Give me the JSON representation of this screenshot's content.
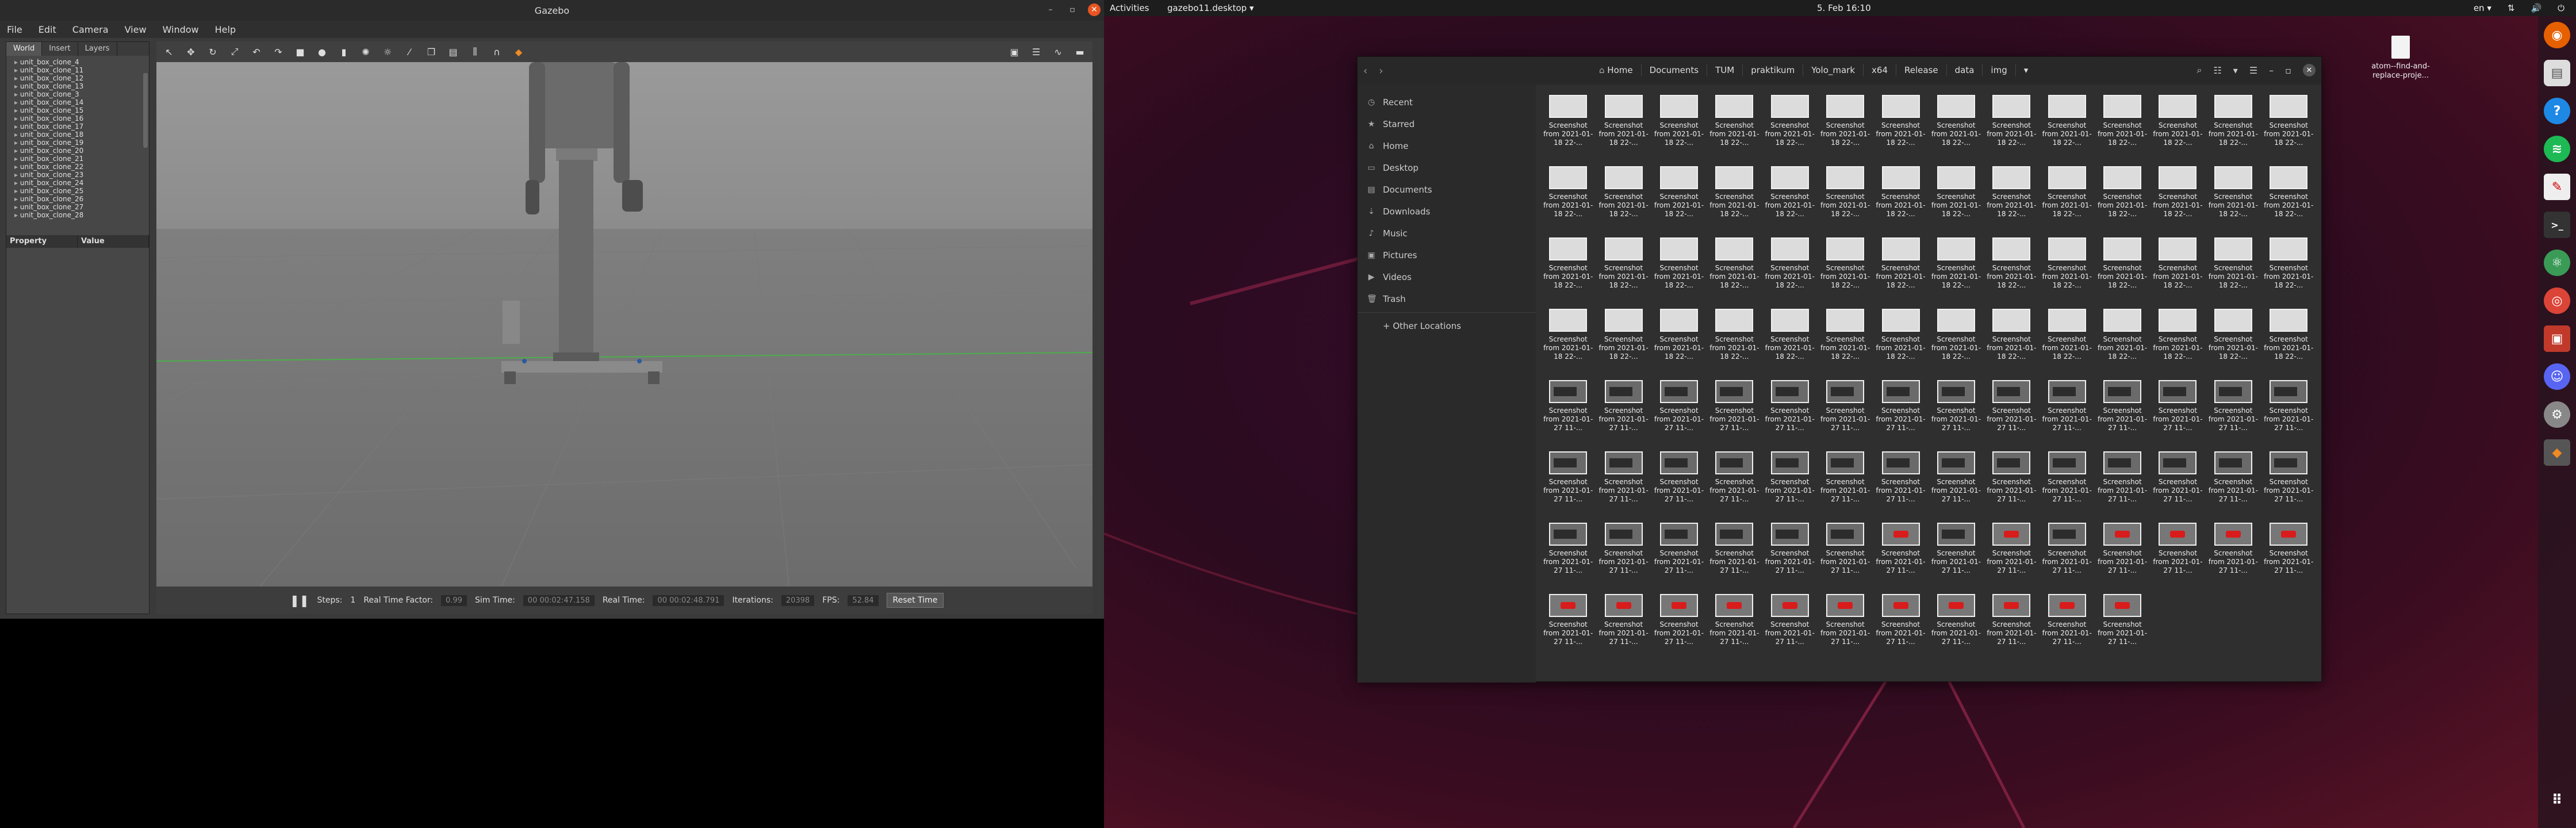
{
  "gazebo": {
    "title": "Gazebo",
    "menu": [
      "File",
      "Edit",
      "Camera",
      "View",
      "Window",
      "Help"
    ],
    "tabs": [
      "World",
      "Insert",
      "Layers"
    ],
    "tree_items": [
      "unit_box_clone_4",
      "unit_box_clone_11",
      "unit_box_clone_12",
      "unit_box_clone_13",
      "unit_box_clone_3",
      "unit_box_clone_14",
      "unit_box_clone_15",
      "unit_box_clone_16",
      "unit_box_clone_17",
      "unit_box_clone_18",
      "unit_box_clone_19",
      "unit_box_clone_20",
      "unit_box_clone_21",
      "unit_box_clone_22",
      "unit_box_clone_23",
      "unit_box_clone_24",
      "unit_box_clone_25",
      "unit_box_clone_26",
      "unit_box_clone_27",
      "unit_box_clone_28"
    ],
    "property_header": "Property",
    "value_header": "Value",
    "status": {
      "steps_label": "Steps:",
      "steps_value": "1",
      "rtf_label": "Real Time Factor:",
      "rtf_value": "0.99",
      "sim_time_label": "Sim Time:",
      "sim_time_value": "00 00:02:47.158",
      "real_time_label": "Real Time:",
      "real_time_value": "00 00:02:48.791",
      "iterations_label": "Iterations:",
      "iterations_value": "20398",
      "fps_label": "FPS:",
      "fps_value": "52.84",
      "reset_button": "Reset Time"
    }
  },
  "topbar": {
    "activities": "Activities",
    "app_menu": "gazebo11.desktop ▾",
    "datetime": "5. Feb  16:10",
    "lang": "en ▾"
  },
  "desktop_icon": {
    "label": "atom--find-and-replace-proje..."
  },
  "files": {
    "crumbs": [
      "Home",
      "Documents",
      "TUM",
      "praktikum",
      "Yolo_mark",
      "x64",
      "Release",
      "data",
      "img"
    ],
    "sidebar": [
      {
        "label": "Recent",
        "icon": "◷"
      },
      {
        "label": "Starred",
        "icon": "★"
      },
      {
        "label": "Home",
        "icon": "⌂"
      },
      {
        "label": "Desktop",
        "icon": "▭"
      },
      {
        "label": "Documents",
        "icon": "▤"
      },
      {
        "label": "Downloads",
        "icon": "⇣"
      },
      {
        "label": "Music",
        "icon": "♪"
      },
      {
        "label": "Pictures",
        "icon": "▣"
      },
      {
        "label": "Videos",
        "icon": "▶"
      },
      {
        "label": "Trash",
        "icon": "🗑"
      },
      {
        "label": "+ Other Locations",
        "icon": ""
      }
    ],
    "file_name_a": "Screenshot from 2021-01-18 22-...",
    "file_name_b": "Screenshot from 2021-01-27 11-...",
    "count_a": 56,
    "count_b": 53
  }
}
